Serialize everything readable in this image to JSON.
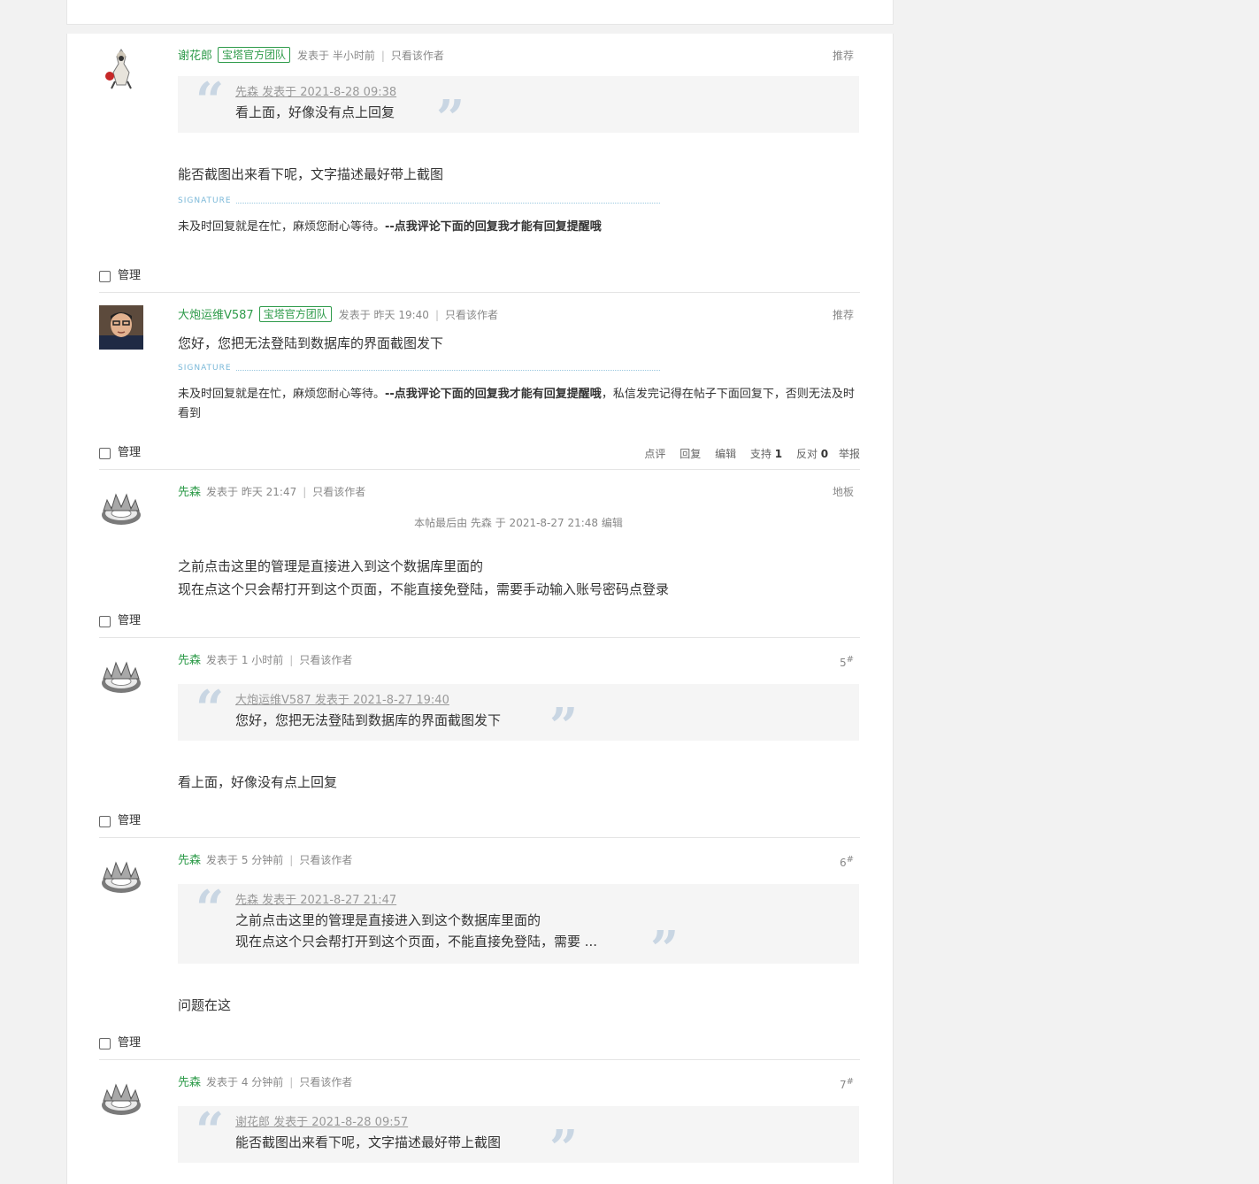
{
  "manage_label": "管理",
  "posts": [
    {
      "author": "谢花郎",
      "badge": "宝塔官方团队",
      "posted": "发表于 半小时前",
      "only_author": "只看该作者",
      "floor": "推荐",
      "quote": {
        "head": "先森 发表于 2021-8-28 09:38",
        "lines": [
          "看上面，好像没有点上回复"
        ]
      },
      "message": [
        "能否截图出来看下呢，文字描述最好带上截图"
      ],
      "signature": {
        "label": "SIGNATURE",
        "text_prefix": "未及时回复就是在忙，麻烦您耐心等待。",
        "text_bold": "--点我评论下面的回复我才能有回复提醒哦"
      }
    },
    {
      "author": "大炮运维V587",
      "badge": "宝塔官方团队",
      "posted": "发表于 昨天 19:40",
      "only_author": "只看该作者",
      "floor": "推荐",
      "message": [
        "您好，您把无法登陆到数据库的界面截图发下"
      ],
      "signature": {
        "label": "SIGNATURE",
        "text_prefix": "未及时回复就是在忙，麻烦您耐心等待。",
        "text_bold": "--点我评论下面的回复我才能有回复提醒哦",
        "text_suffix": "，私信发完记得在帖子下面回复下，否则无法及时看到"
      },
      "actions": {
        "comment": "点评",
        "reply": "回复",
        "edit": "编辑",
        "support_label": "支持",
        "support_count": "1",
        "oppose_label": "反对",
        "oppose_count": "0",
        "report": "举报"
      }
    },
    {
      "author": "先森",
      "posted": "发表于 昨天 21:47",
      "only_author": "只看该作者",
      "floor": "地板",
      "edit_note": "本帖最后由 先森 于 2021-8-27 21:48 编辑",
      "message": [
        "之前点击这里的管理是直接进入到这个数据库里面的",
        "现在点这个只会帮打开到这个页面，不能直接免登陆，需要手动输入账号密码点登录"
      ]
    },
    {
      "author": "先森",
      "posted": "发表于 1 小时前",
      "only_author": "只看该作者",
      "floor_num": "5",
      "floor_sup": "#",
      "quote": {
        "head": "大炮运维V587 发表于 2021-8-27 19:40",
        "lines": [
          "您好，您把无法登陆到数据库的界面截图发下"
        ]
      },
      "message": [
        "看上面，好像没有点上回复"
      ]
    },
    {
      "author": "先森",
      "posted": "发表于 5 分钟前",
      "only_author": "只看该作者",
      "floor_num": "6",
      "floor_sup": "#",
      "quote": {
        "head": "先森 发表于 2021-8-27 21:47",
        "lines": [
          "之前点击这里的管理是直接进入到这个数据库里面的",
          "现在点这个只会帮打开到这个页面，不能直接免登陆，需要 ..."
        ]
      },
      "message": [
        "问题在这"
      ]
    },
    {
      "author": "先森",
      "posted": "发表于 4 分钟前",
      "only_author": "只看该作者",
      "floor_num": "7",
      "floor_sup": "#",
      "quote": {
        "head": "谢花郎 发表于 2021-8-28 09:57",
        "lines": [
          "能否截图出来看下呢，文字描述最好带上截图"
        ]
      }
    }
  ]
}
